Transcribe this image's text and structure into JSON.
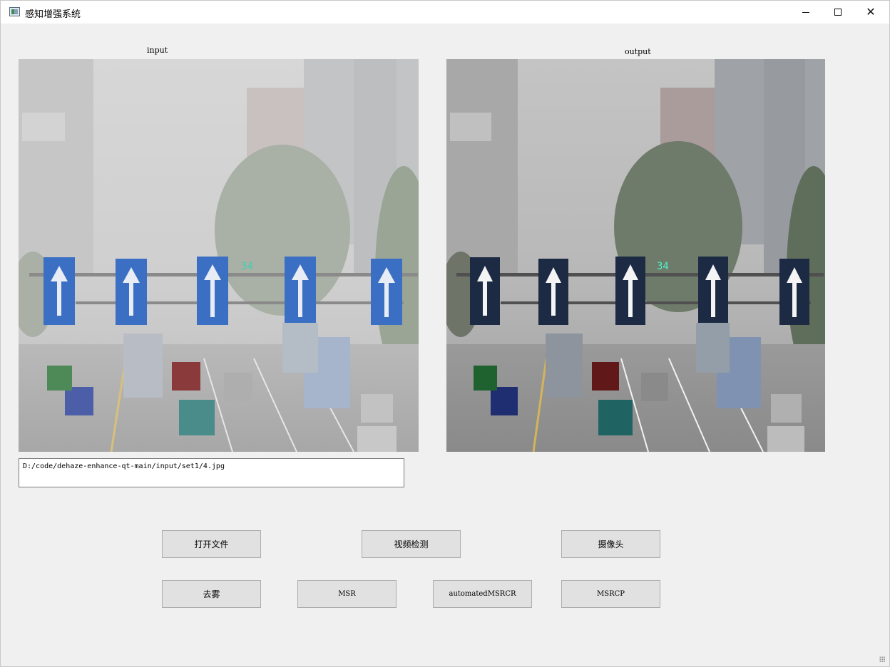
{
  "window": {
    "title": "感知增强系统",
    "controls": {
      "minimize": "—",
      "maximize": "☐",
      "close": "✕"
    }
  },
  "panels": {
    "input_label": "input",
    "output_label": "output",
    "sign_number": "34"
  },
  "path_field": {
    "value": "D:/code/dehaze-enhance-qt-main/input/set1/4.jpg"
  },
  "buttons": {
    "open_file": "打开文件",
    "video_detect": "视频检测",
    "camera": "摄像头",
    "dehaze": "去雾",
    "msr": "MSR",
    "automated_msrcr": "automatedMSRCR",
    "msrcp": "MSRCP"
  },
  "colors": {
    "window_bg": "#f0f0f0",
    "button_bg": "#e1e1e1",
    "sign_blue_input": "#3a6fc4",
    "sign_blue_output": "#1c2a44"
  }
}
